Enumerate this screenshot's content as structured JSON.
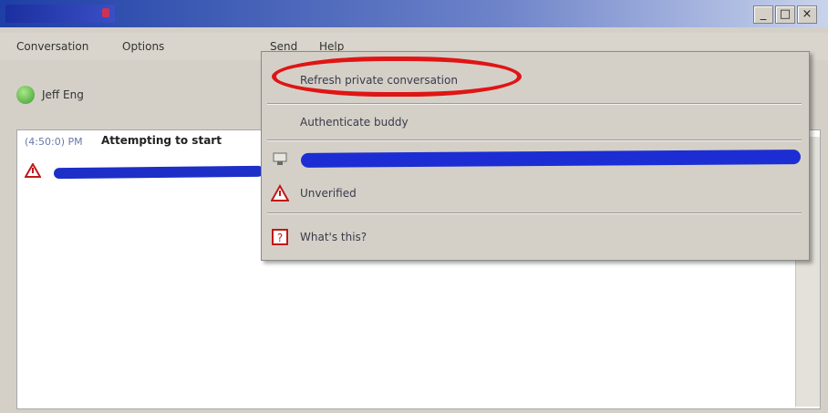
{
  "window": {
    "controls": [
      "_",
      "□",
      "×"
    ]
  },
  "menubar": {
    "items": [
      "Conversation",
      "Options",
      "Send",
      "Help"
    ]
  },
  "contact": {
    "name": "Jeff Eng",
    "status_color": "#3d9a2c"
  },
  "log": {
    "timestamp": "(4:50:0) PM",
    "message": "Attempting to start"
  },
  "dropdown": {
    "items": [
      {
        "label": "Refresh private conversation",
        "highlighted": true
      },
      {
        "label": "Authenticate buddy"
      },
      {
        "label": "",
        "redacted": true,
        "icon": "buddy-icon"
      },
      {
        "label": "Unverified",
        "icon": "warning-icon"
      },
      {
        "label": "What's this?",
        "icon": "help-icon"
      }
    ]
  },
  "colors": {
    "titlebar": "#1d3fa6",
    "redaction": "#1c2ed3",
    "highlight": "#e01515"
  }
}
